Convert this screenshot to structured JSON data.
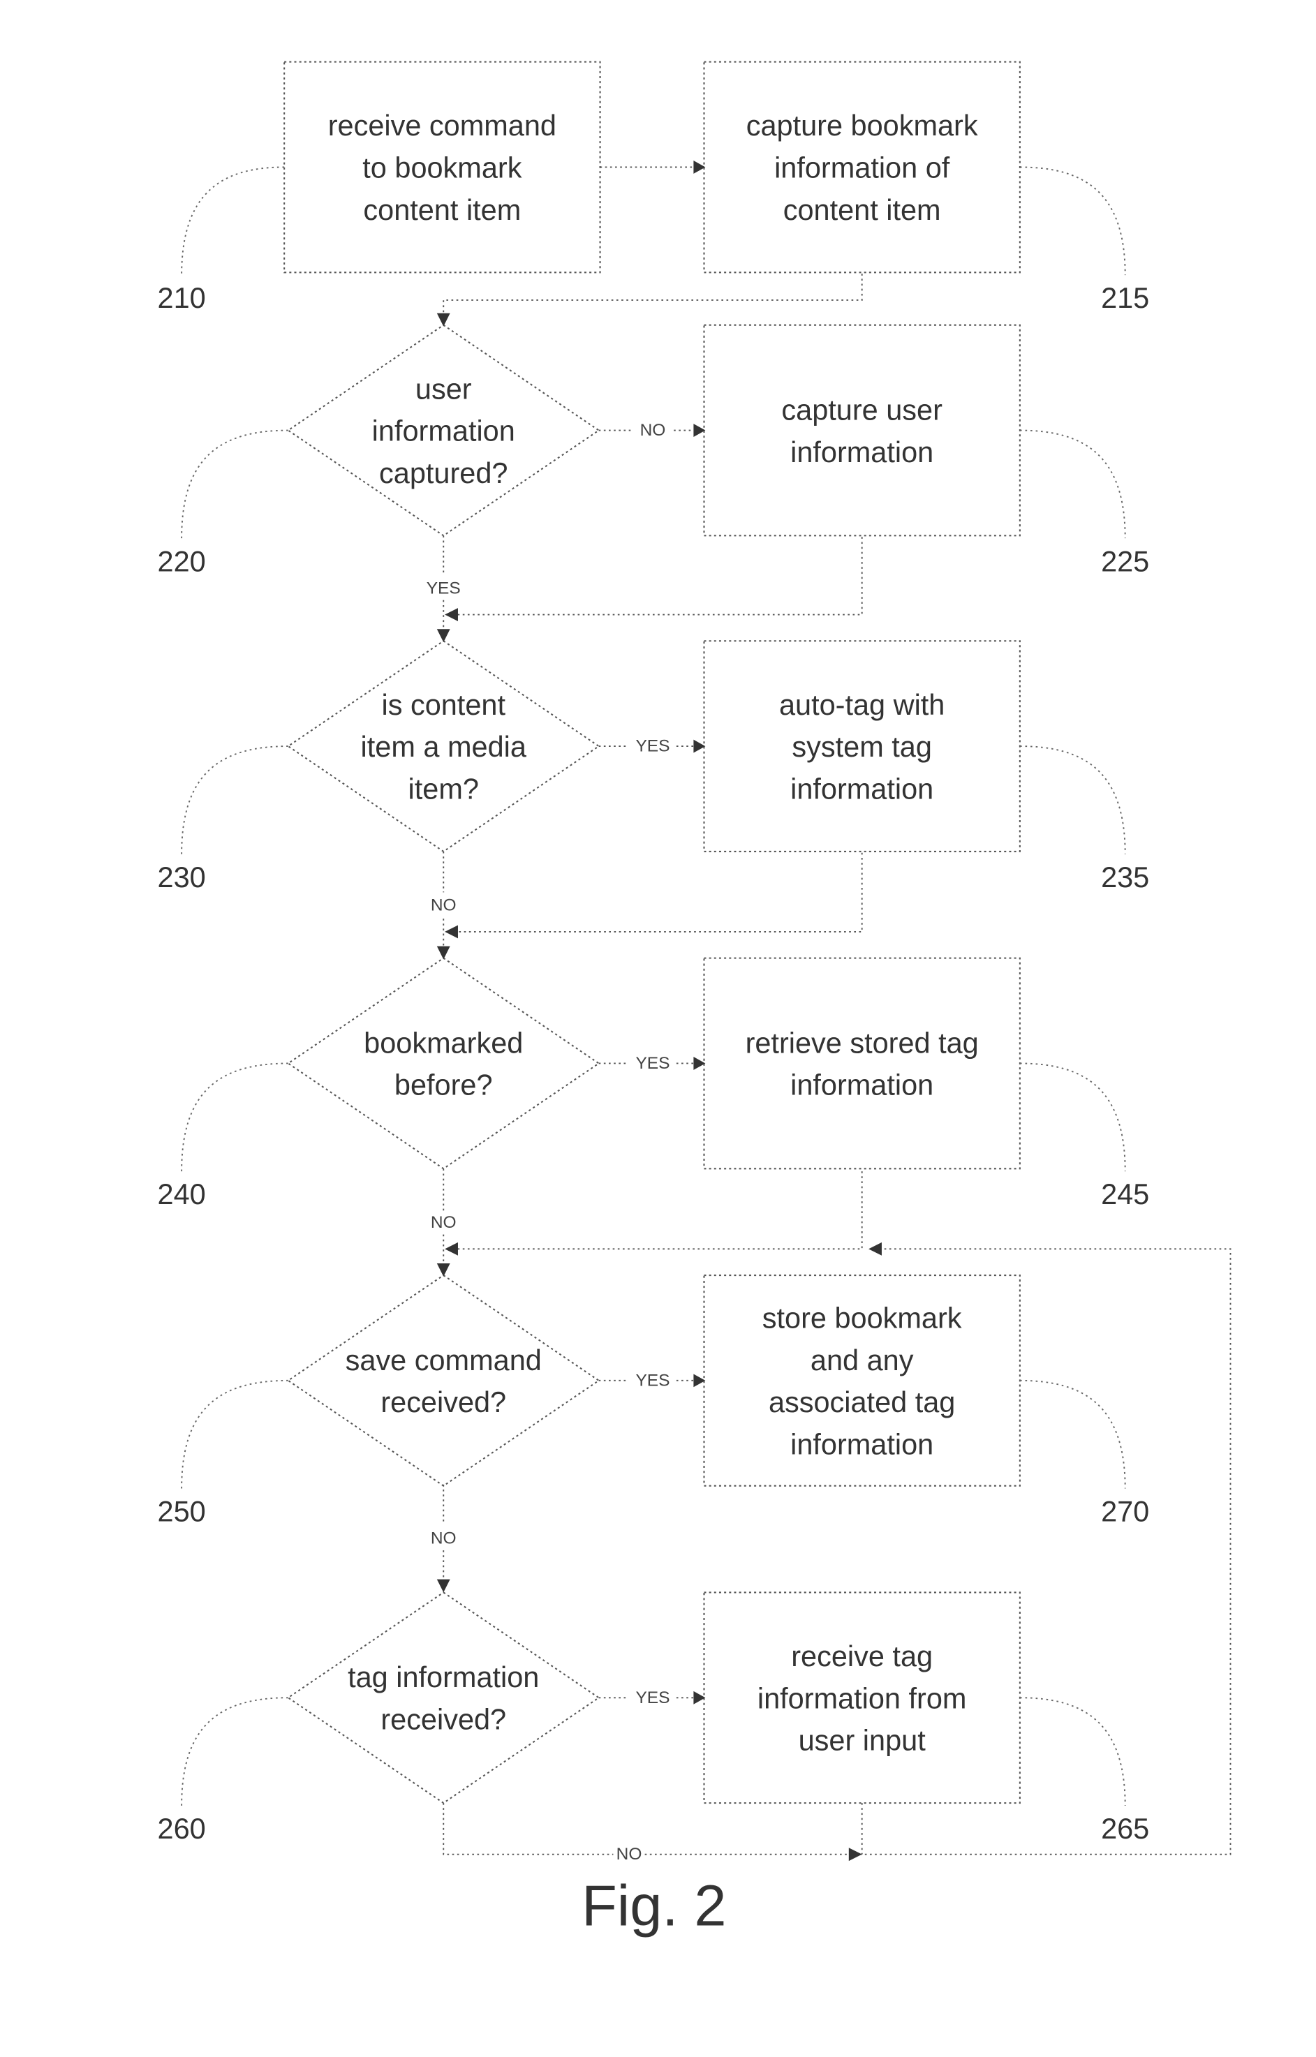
{
  "figure_label": "Fig. 2",
  "nodes": [
    {
      "id": "210",
      "type": "process",
      "lines": [
        "receive command",
        "to bookmark",
        "content item"
      ]
    },
    {
      "id": "215",
      "type": "process",
      "lines": [
        "capture bookmark",
        "information of",
        "content item"
      ]
    },
    {
      "id": "220",
      "type": "decision",
      "lines": [
        "user",
        "information",
        "captured?"
      ]
    },
    {
      "id": "225",
      "type": "process",
      "lines": [
        "capture user",
        "information"
      ]
    },
    {
      "id": "230",
      "type": "decision",
      "lines": [
        "is content",
        "item a media",
        "item?"
      ]
    },
    {
      "id": "235",
      "type": "process",
      "lines": [
        "auto-tag with",
        "system tag",
        "information"
      ]
    },
    {
      "id": "240",
      "type": "decision",
      "lines": [
        "bookmarked",
        "before?"
      ]
    },
    {
      "id": "245",
      "type": "process",
      "lines": [
        "retrieve stored tag",
        "information"
      ]
    },
    {
      "id": "250",
      "type": "decision",
      "lines": [
        "save command",
        "received?"
      ]
    },
    {
      "id": "270",
      "type": "process",
      "lines": [
        "store bookmark",
        "and any",
        "associated tag",
        "information"
      ]
    },
    {
      "id": "260",
      "type": "decision",
      "lines": [
        "tag information",
        "received?"
      ]
    },
    {
      "id": "265",
      "type": "process",
      "lines": [
        "receive tag",
        "information from",
        "user input"
      ]
    }
  ],
  "branch_labels": {
    "d220_no": "NO",
    "d220_yes": "YES",
    "d230_yes": "YES",
    "d230_no": "NO",
    "d240_yes": "YES",
    "d240_no": "NO",
    "d250_yes": "YES",
    "d250_no": "NO",
    "d260_yes": "YES",
    "d260_no": "NO"
  },
  "edges": [
    {
      "from": "210",
      "to": "215"
    },
    {
      "from": "215",
      "to": "220"
    },
    {
      "from": "220",
      "to": "225",
      "label": "NO"
    },
    {
      "from": "220",
      "to": "230",
      "label": "YES"
    },
    {
      "from": "225",
      "to": "230"
    },
    {
      "from": "230",
      "to": "235",
      "label": "YES"
    },
    {
      "from": "230",
      "to": "240",
      "label": "NO"
    },
    {
      "from": "235",
      "to": "240"
    },
    {
      "from": "240",
      "to": "245",
      "label": "YES"
    },
    {
      "from": "240",
      "to": "250",
      "label": "NO"
    },
    {
      "from": "245",
      "to": "250"
    },
    {
      "from": "250",
      "to": "270",
      "label": "YES"
    },
    {
      "from": "250",
      "to": "260",
      "label": "NO"
    },
    {
      "from": "260",
      "to": "265",
      "label": "YES"
    },
    {
      "from": "260",
      "to": "250",
      "label": "NO"
    },
    {
      "from": "265",
      "to": "250"
    }
  ]
}
